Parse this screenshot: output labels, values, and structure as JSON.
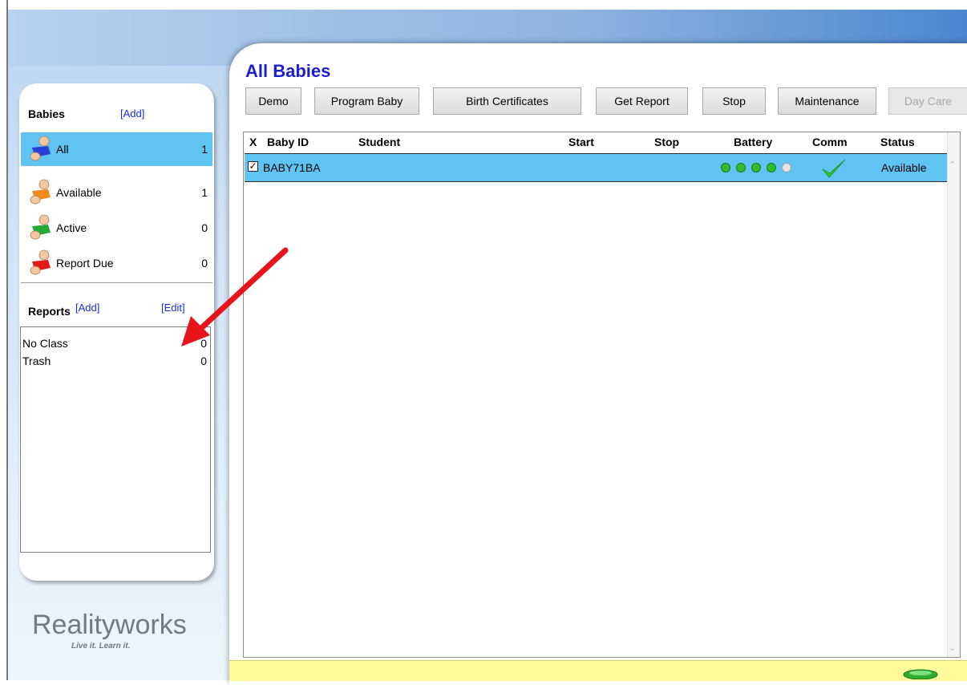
{
  "sidebar": {
    "babies_title": "Babies",
    "babies_add": "[Add]",
    "items": [
      {
        "label": "All",
        "count": "1",
        "color": "#2a3fd4"
      },
      {
        "label": "Available",
        "count": "1",
        "color": "#f08a1c"
      },
      {
        "label": "Active",
        "count": "0",
        "color": "#26a838"
      },
      {
        "label": "Report Due",
        "count": "0",
        "color": "#e01818"
      }
    ],
    "reports_title": "Reports",
    "reports_add": "[Add]",
    "reports_edit": "[Edit]",
    "reports": [
      {
        "label": "No Class",
        "count": "0"
      },
      {
        "label": "Trash",
        "count": "0"
      }
    ]
  },
  "logo": {
    "name": "Realityworks",
    "tagline": "Live it. Learn it."
  },
  "main": {
    "title": "All Babies",
    "toolbar": {
      "demo": "Demo",
      "program_baby": "Program Baby",
      "birth_certificates": "Birth Certificates",
      "get_report": "Get Report",
      "stop": "Stop",
      "maintenance": "Maintenance",
      "day_care": "Day Care"
    },
    "table": {
      "columns": {
        "x": "X",
        "baby_id": "Baby ID",
        "student": "Student",
        "start": "Start",
        "stop": "Stop",
        "battery": "Battery",
        "comm": "Comm",
        "status": "Status"
      },
      "rows": [
        {
          "checked": true,
          "baby_id": "BABY71BA",
          "student": "",
          "start": "",
          "stop": "",
          "battery_level": 4,
          "battery_max": 5,
          "comm_ok": true,
          "status": "Available"
        }
      ]
    }
  },
  "colors": {
    "selection": "#5fc4f4",
    "title_blue": "#1a20d0",
    "link_blue": "#1a2fd6",
    "status_bar": "#fffa9c",
    "annotation_arrow": "#e8141c"
  },
  "icons": {
    "sort": "sort-triangle-icon",
    "check": "green-check-icon",
    "battery": "battery-dot-icon",
    "led": "green-led-icon"
  }
}
